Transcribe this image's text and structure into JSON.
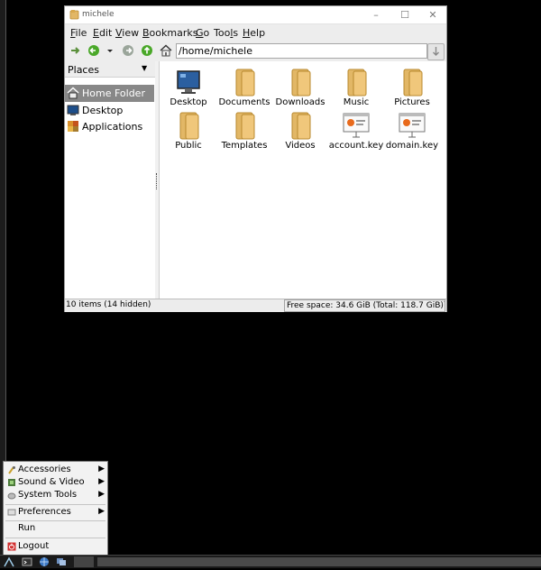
{
  "window": {
    "title": "michele",
    "controls": {
      "minimize": "–",
      "maximize": "☐",
      "close": "✕"
    }
  },
  "menubar": [
    {
      "u": "F",
      "rest": "ile"
    },
    {
      "u": "E",
      "rest": "dit"
    },
    {
      "u": "V",
      "rest": "iew"
    },
    {
      "u": "B",
      "rest": "ookmarks"
    },
    {
      "u": "G",
      "rest": "o"
    },
    {
      "pre": "Too",
      "u": "l",
      "rest": "s"
    },
    {
      "u": "H",
      "rest": "elp"
    }
  ],
  "toolbar": {
    "path": "/home/michele",
    "icons": [
      "up-arrow-icon",
      "back-icon",
      "history-dropdown-icon",
      "forward-icon",
      "parent-icon",
      "home-icon",
      "go-icon"
    ]
  },
  "sidebar": {
    "header": "Places",
    "items": [
      {
        "label": "Home Folder",
        "icon": "home-icon",
        "selected": true
      },
      {
        "label": "Desktop",
        "icon": "desktop-icon",
        "selected": false
      },
      {
        "label": "Applications",
        "icon": "applications-icon",
        "selected": false
      }
    ]
  },
  "files": [
    {
      "name": "Desktop",
      "icon": "desktop-icon"
    },
    {
      "name": "Documents",
      "icon": "folder-icon"
    },
    {
      "name": "Downloads",
      "icon": "folder-icon"
    },
    {
      "name": "Music",
      "icon": "folder-icon"
    },
    {
      "name": "Pictures",
      "icon": "folder-icon"
    },
    {
      "name": "Public",
      "icon": "folder-icon"
    },
    {
      "name": "Templates",
      "icon": "folder-icon"
    },
    {
      "name": "Videos",
      "icon": "folder-icon"
    },
    {
      "name": "account.key",
      "icon": "presentation-file-icon"
    },
    {
      "name": "domain.key",
      "icon": "presentation-file-icon"
    }
  ],
  "status": {
    "items": "10 items (14 hidden)",
    "free_space": "Free space: 34.6 GiB (Total: 118.7 GiB)"
  },
  "start_menu": {
    "items": [
      {
        "label": "Accessories",
        "icon": "accessories-icon",
        "submenu": true
      },
      {
        "label": "Sound & Video",
        "icon": "sound-video-icon",
        "submenu": true
      },
      {
        "label": "System Tools",
        "icon": "system-tools-icon",
        "submenu": true
      },
      {
        "label": "Preferences",
        "icon": "preferences-icon",
        "submenu": true
      },
      {
        "label": "Run",
        "icon": "",
        "submenu": false
      },
      {
        "label": "Logout",
        "icon": "logout-icon",
        "submenu": false
      }
    ],
    "submenu_arrow": "▶"
  },
  "colors": {
    "folder": "#e2b766",
    "selection": "#888888",
    "green_nav": "#4aa829",
    "desktop_black": "#000000"
  }
}
